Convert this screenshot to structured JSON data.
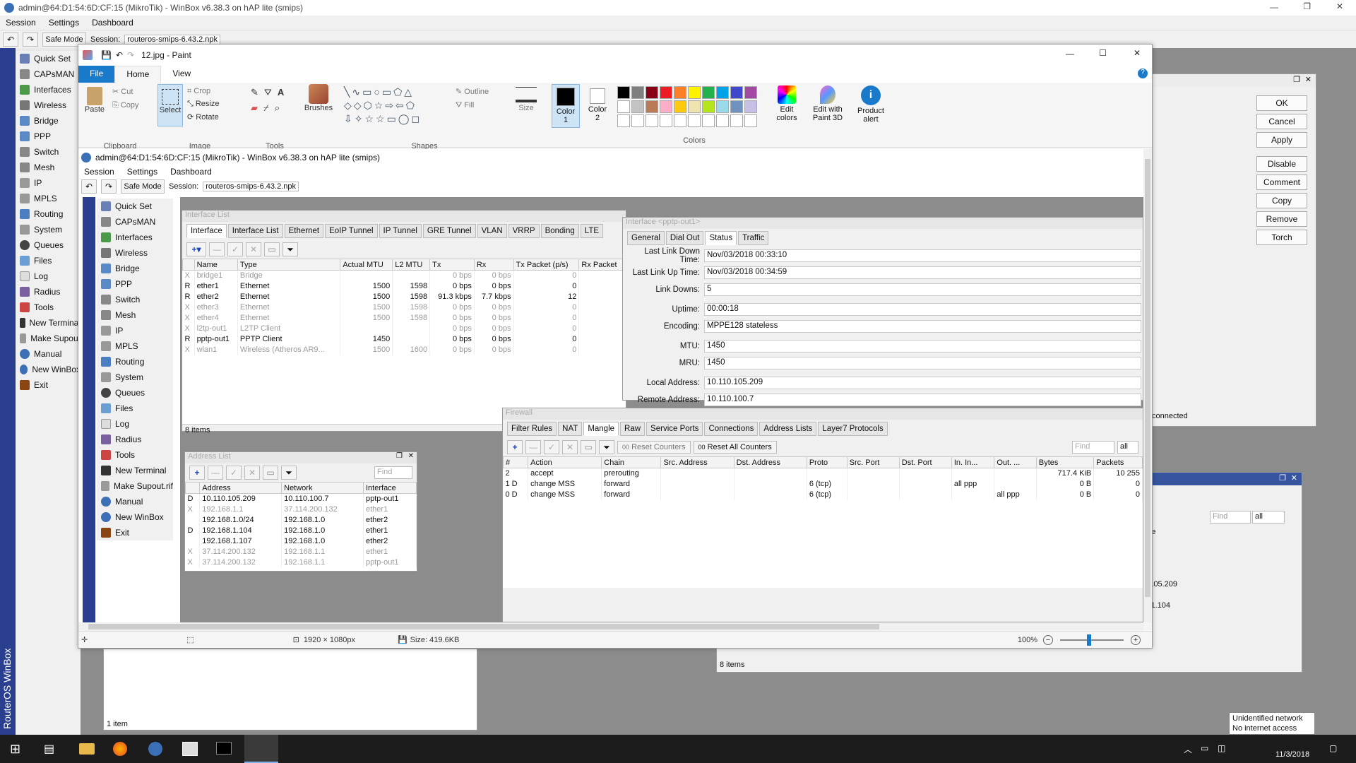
{
  "outer": {
    "title": "admin@64:D1:54:6D:CF:15 (MikroTik) - WinBox v6.38.3 on hAP lite (smips)",
    "menu": [
      "Session",
      "Settings",
      "Dashboard"
    ],
    "safe_mode": "Safe Mode",
    "session_label": "Session:",
    "session_value": "routeros-smips-6.43.2.npk",
    "sidebar": [
      "Quick Set",
      "CAPsMAN",
      "Interfaces",
      "Wireless",
      "Bridge",
      "PPP",
      "Switch",
      "Mesh",
      "IP",
      "MPLS",
      "Routing",
      "System",
      "Queues",
      "Files",
      "Log",
      "Radius",
      "Tools",
      "New Terminal",
      "Make Supout",
      "Manual",
      "New WinBox",
      "Exit"
    ],
    "brand": "RouterOS WinBox",
    "right_buttons": [
      "OK",
      "Cancel",
      "Apply",
      "Disable",
      "Comment",
      "Copy",
      "Remove",
      "Torch"
    ],
    "connected": "connected",
    "items_8": "8 items",
    "items_1": "1 item",
    "ip1": ".105.209",
    "ip2": "8.1.104",
    "ource": "ource",
    "find": "Find",
    "all": "all"
  },
  "paint": {
    "title": "12.jpg - Paint",
    "tabs": [
      "File",
      "Home",
      "View"
    ],
    "groups": {
      "clipboard": "Clipboard",
      "image": "Image",
      "tools": "Tools",
      "shapes": "Shapes",
      "colors": "Colors"
    },
    "paste": "Paste",
    "cut": "Cut",
    "copy": "Copy",
    "select": "Select",
    "crop": "Crop",
    "resize": "Resize",
    "rotate": "Rotate",
    "brushes": "Brushes",
    "outline": "Outline",
    "fill": "Fill",
    "size": "Size",
    "color1": "Color 1",
    "color2": "Color 2",
    "edit_colors": "Edit colors",
    "paint3d": "Edit with Paint 3D",
    "alert": "Product alert",
    "dims": "1920 × 1080px",
    "filesize": "Size: 419.6KB",
    "zoom": "100%"
  },
  "inner": {
    "title": "admin@64:D1:54:6D:CF:15 (MikroTik) - WinBox v6.38.3 on hAP lite (smips)",
    "menu": [
      "Session",
      "Settings",
      "Dashboard"
    ],
    "safe_mode": "Safe Mode",
    "session_label": "Session:",
    "session_value": "routeros-smips-6.43.2.npk",
    "sidebar": [
      "Quick Set",
      "CAPsMAN",
      "Interfaces",
      "Wireless",
      "Bridge",
      "PPP",
      "Switch",
      "Mesh",
      "IP",
      "MPLS",
      "Routing",
      "System",
      "Queues",
      "Files",
      "Log",
      "Radius",
      "Tools",
      "New Terminal",
      "Make Supout.rif",
      "Manual",
      "New WinBox",
      "Exit"
    ]
  },
  "iflist": {
    "title": "Interface List",
    "tabs": [
      "Interface",
      "Interface List",
      "Ethernet",
      "EoIP Tunnel",
      "IP Tunnel",
      "GRE Tunnel",
      "VLAN",
      "VRRP",
      "Bonding",
      "LTE"
    ],
    "cols": [
      "",
      "Name",
      "Type",
      "Actual MTU",
      "L2 MTU",
      "Tx",
      "Rx",
      "Tx Packet (p/s)",
      "Rx Packet"
    ],
    "rows": [
      [
        "X",
        "bridge1",
        "Bridge",
        "",
        "",
        "0 bps",
        "0 bps",
        "0"
      ],
      [
        "R",
        "ether1",
        "Ethernet",
        "1500",
        "1598",
        "0 bps",
        "0 bps",
        "0"
      ],
      [
        "R",
        "ether2",
        "Ethernet",
        "1500",
        "1598",
        "91.3 kbps",
        "7.7 kbps",
        "12"
      ],
      [
        "X",
        "ether3",
        "Ethernet",
        "1500",
        "1598",
        "0 bps",
        "0 bps",
        "0"
      ],
      [
        "X",
        "ether4",
        "Ethernet",
        "1500",
        "1598",
        "0 bps",
        "0 bps",
        "0"
      ],
      [
        "X",
        "l2tp-out1",
        "L2TP Client",
        "",
        "",
        "0 bps",
        "0 bps",
        "0"
      ],
      [
        "R",
        "pptp-out1",
        "PPTP Client",
        "1450",
        "",
        "0 bps",
        "0 bps",
        "0"
      ],
      [
        "X",
        "wlan1",
        "Wireless (Atheros AR9...",
        "1500",
        "1600",
        "0 bps",
        "0 bps",
        "0"
      ]
    ],
    "count": "8 items"
  },
  "pptp": {
    "title": "Interface <pptp-out1>",
    "tabs": [
      "General",
      "Dial Out",
      "Status",
      "Traffic"
    ],
    "fields": [
      [
        "Last Link Down Time:",
        "Nov/03/2018 00:33:10"
      ],
      [
        "Last Link Up Time:",
        "Nov/03/2018 00:34:59"
      ],
      [
        "Link Downs:",
        "5"
      ],
      [
        "Uptime:",
        "00:00:18"
      ],
      [
        "Encoding:",
        "MPPE128 stateless"
      ],
      [
        "MTU:",
        "1450"
      ],
      [
        "MRU:",
        "1450"
      ],
      [
        "Local Address:",
        "10.110.105.209"
      ],
      [
        "Remote Address:",
        "10.110.100.7"
      ]
    ]
  },
  "addr": {
    "title": "Address List",
    "find": "Find",
    "cols": [
      "",
      "Address",
      "Network",
      "Interface"
    ],
    "rows": [
      [
        "D",
        "10.110.105.209",
        "10.110.100.7",
        "pptp-out1"
      ],
      [
        "X",
        "192.168.1.1",
        "37.114.200.132",
        "ether1"
      ],
      [
        "",
        "192.168.1.0/24",
        "192.168.1.0",
        "ether2"
      ],
      [
        "D",
        "192.168.1.104",
        "192.168.1.0",
        "ether1"
      ],
      [
        "",
        "192.168.1.107",
        "192.168.1.0",
        "ether2"
      ],
      [
        "X",
        "37.114.200.132",
        "192.168.1.1",
        "ether1"
      ],
      [
        "X",
        "37.114.200.132",
        "192.168.1.1",
        "pptp-out1"
      ]
    ]
  },
  "fw": {
    "title": "Firewall",
    "tabs": [
      "Filter Rules",
      "NAT",
      "Mangle",
      "Raw",
      "Service Ports",
      "Connections",
      "Address Lists",
      "Layer7 Protocols"
    ],
    "reset": "Reset Counters",
    "reset_all": "Reset All Counters",
    "find": "Find",
    "all": "all",
    "oo": "00",
    "cols": [
      "#",
      "Action",
      "Chain",
      "Src. Address",
      "Dst. Address",
      "Proto",
      "Src. Port",
      "Dst. Port",
      "In. In...",
      "Out. ...",
      "Bytes",
      "Packets"
    ],
    "rows": [
      [
        "2",
        "accept",
        "prerouting",
        "",
        "",
        "",
        "",
        "",
        "",
        "",
        "717.4 KiB",
        "10 255"
      ],
      [
        "1 D",
        "change MSS",
        "forward",
        "",
        "",
        "6 (tcp)",
        "",
        "",
        "all ppp",
        "",
        "0 B",
        "0"
      ],
      [
        "0 D",
        "change MSS",
        "forward",
        "",
        "",
        "6 (tcp)",
        "",
        "",
        "",
        "all ppp",
        "0 B",
        "0"
      ]
    ]
  },
  "tray": {
    "network": "Unidentified network",
    "access": "No internet access",
    "date": "11/3/2018"
  },
  "colors": {
    "palette1": [
      "#000000",
      "#7f7f7f",
      "#880015",
      "#ed1c24",
      "#ff7f27",
      "#fff200",
      "#22b14c",
      "#00a2e8",
      "#3f48cc",
      "#a349a4"
    ],
    "palette2": [
      "#ffffff",
      "#c3c3c3",
      "#b97a57",
      "#ffaec9",
      "#ffc90e",
      "#efe4b0",
      "#b5e61d",
      "#99d9ea",
      "#7092be",
      "#c8bfe7"
    ]
  }
}
